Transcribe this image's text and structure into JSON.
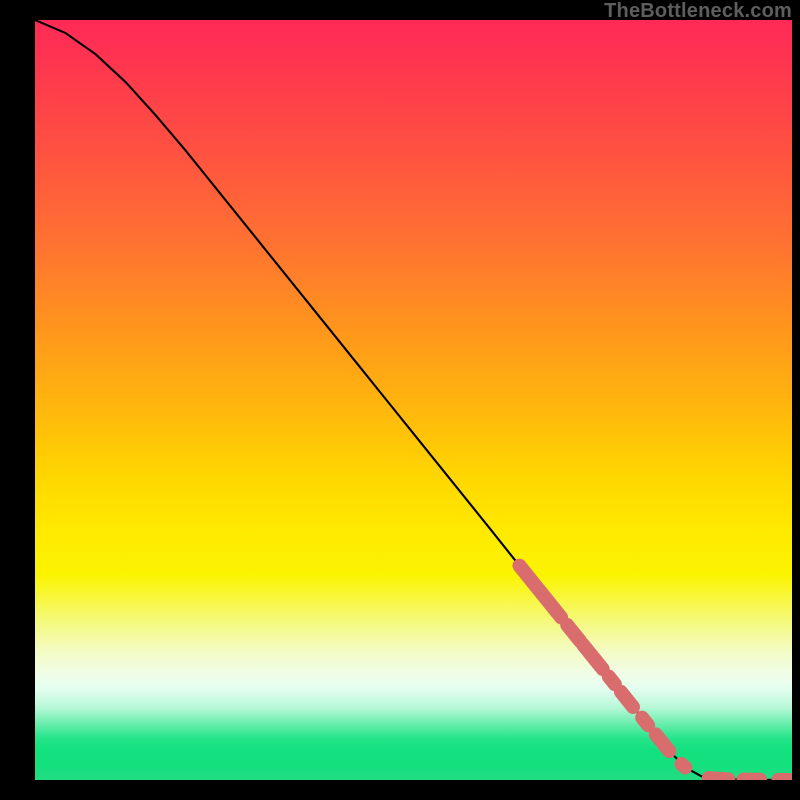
{
  "attribution": "TheBottleneck.com",
  "colors": {
    "marker": "#d96d6d",
    "marker_stroke": "#c45f5f",
    "line": "#000000",
    "background_black": "#000000"
  },
  "chart_data": {
    "type": "line",
    "title": "",
    "xlabel": "",
    "ylabel": "",
    "xlim": [
      0,
      100
    ],
    "ylim": [
      0,
      100
    ],
    "grid": false,
    "legend": false,
    "curve": [
      {
        "x": 0,
        "y": 100
      },
      {
        "x": 4,
        "y": 98.3
      },
      {
        "x": 8,
        "y": 95.5
      },
      {
        "x": 12,
        "y": 91.8
      },
      {
        "x": 16,
        "y": 87.4
      },
      {
        "x": 20,
        "y": 82.7
      },
      {
        "x": 28,
        "y": 72.8
      },
      {
        "x": 36,
        "y": 62.9
      },
      {
        "x": 44,
        "y": 53.0
      },
      {
        "x": 52,
        "y": 43.1
      },
      {
        "x": 60,
        "y": 33.2
      },
      {
        "x": 64,
        "y": 28.2
      },
      {
        "x": 68,
        "y": 23.3
      },
      {
        "x": 72,
        "y": 18.3
      },
      {
        "x": 76,
        "y": 13.4
      },
      {
        "x": 80,
        "y": 8.4
      },
      {
        "x": 84,
        "y": 3.6
      },
      {
        "x": 86,
        "y": 1.6
      },
      {
        "x": 88,
        "y": 0.5
      },
      {
        "x": 90,
        "y": 0.12
      },
      {
        "x": 94,
        "y": 0.04
      },
      {
        "x": 100,
        "y": 0
      }
    ],
    "marker_segments": [
      {
        "x1": 64.0,
        "y1": 28.2,
        "x2": 69.5,
        "y2": 21.4,
        "kind": "thick"
      },
      {
        "x1": 70.3,
        "y1": 20.4,
        "x2": 72.0,
        "y2": 18.3,
        "kind": "thick"
      },
      {
        "x1": 72.4,
        "y1": 17.8,
        "x2": 75.0,
        "y2": 14.6,
        "kind": "thick"
      },
      {
        "x1": 75.8,
        "y1": 13.6,
        "x2": 76.6,
        "y2": 12.6,
        "kind": "thick"
      },
      {
        "x1": 77.4,
        "y1": 11.6,
        "x2": 79.0,
        "y2": 9.6,
        "kind": "thick"
      },
      {
        "x1": 80.2,
        "y1": 8.2,
        "x2": 81.0,
        "y2": 7.2,
        "kind": "thick"
      },
      {
        "x1": 82.0,
        "y1": 6.0,
        "x2": 83.8,
        "y2": 3.8,
        "kind": "thick"
      },
      {
        "x1": 85.4,
        "y1": 2.1,
        "x2": 85.9,
        "y2": 1.65,
        "kind": "thick"
      },
      {
        "x1": 89.0,
        "y1": 0.25,
        "x2": 91.6,
        "y2": 0.08,
        "kind": "flat"
      },
      {
        "x1": 93.6,
        "y1": 0.05,
        "x2": 95.8,
        "y2": 0.03,
        "kind": "flat"
      },
      {
        "x1": 98.2,
        "y1": 0.01,
        "x2": 99.6,
        "y2": 0.0,
        "kind": "flat"
      }
    ]
  }
}
